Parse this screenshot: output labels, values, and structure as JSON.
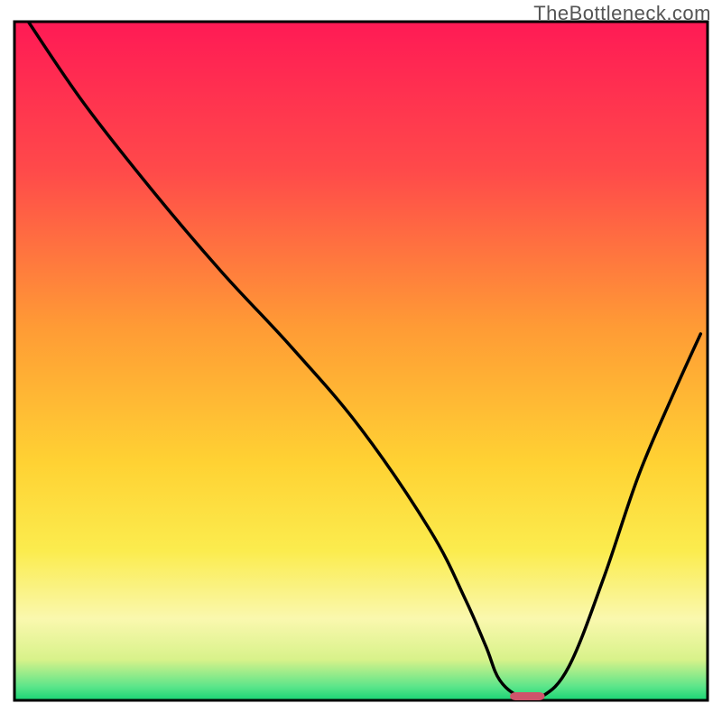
{
  "watermark": "TheBottleneck.com",
  "chart_data": {
    "type": "line",
    "title": "",
    "xlabel": "",
    "ylabel": "",
    "xlim": [
      0,
      100
    ],
    "ylim": [
      0,
      100
    ],
    "grid": false,
    "legend": false,
    "background_gradient": {
      "top": "#ff1a55",
      "mid_upper": "#ff7b3a",
      "mid_lower": "#ffe235",
      "lower_band": "#fbf9a5",
      "bottom": "#24e07a"
    },
    "series": [
      {
        "name": "bottleneck-curve",
        "x": [
          2,
          10,
          20,
          30,
          40,
          50,
          60,
          65,
          68,
          70,
          73,
          76,
          80,
          85,
          90,
          95,
          99
        ],
        "values": [
          100,
          88,
          75,
          63,
          52,
          40,
          25,
          15,
          8,
          3,
          0.5,
          0.5,
          5,
          18,
          33,
          45,
          54
        ],
        "stroke": "#000000"
      }
    ],
    "marker": {
      "name": "optimum-marker",
      "x": 74,
      "y": 0,
      "width": 5,
      "height": 1.2,
      "fill": "#cf546b"
    }
  }
}
